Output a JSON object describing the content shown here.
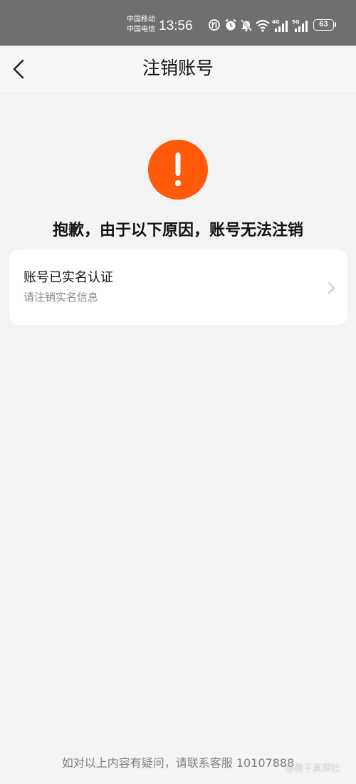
{
  "status_bar": {
    "carrier_1": "中国移动",
    "carrier_2": "中国电信",
    "time": "13:56",
    "net_1": "4G",
    "net_2": "5G",
    "battery": "63"
  },
  "header": {
    "title": "注销账号"
  },
  "warning": {
    "message": "抱歉，由于以下原因，账号无法注销",
    "color": "#ff5a0a"
  },
  "reasons": [
    {
      "title": "账号已实名认证",
      "subtitle": "请注销实名信息"
    }
  ],
  "footer": {
    "text": "如对以上内容有疑问，请联系客服 10107888"
  },
  "watermark": {
    "text": "@橙子真探社"
  }
}
